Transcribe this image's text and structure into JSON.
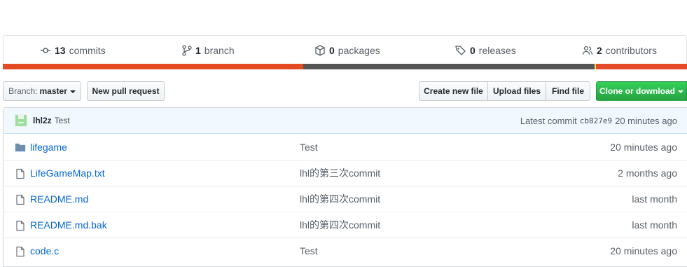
{
  "summary": {
    "commits": {
      "count": "13",
      "label": "commits"
    },
    "branch": {
      "count": "1",
      "label": "branch"
    },
    "packages": {
      "count": "0",
      "label": "packages"
    },
    "releases": {
      "count": "0",
      "label": "releases"
    },
    "contributors": {
      "count": "2",
      "label": "contributors"
    }
  },
  "language_colors": [
    "#e44b23",
    "#555555",
    "#f1e05a",
    "#e34c26"
  ],
  "toolbar": {
    "branch_prefix": "Branch:",
    "branch_name": "master",
    "new_pull_request": "New pull request",
    "create_new_file": "Create new file",
    "upload_files": "Upload files",
    "find_file": "Find file",
    "clone_or_download": "Clone or download"
  },
  "commit_tease": {
    "author": "lhl2z",
    "message": "Test",
    "latest_label": "Latest commit",
    "sha": "cb827e9",
    "age": "20 minutes ago"
  },
  "files": [
    {
      "type": "folder",
      "name": "lifegame",
      "message": "Test",
      "age": "20 minutes ago"
    },
    {
      "type": "file",
      "name": "LifeGameMap.txt",
      "message": "lhl的第三次commit",
      "age": "2 months ago"
    },
    {
      "type": "file",
      "name": "README.md",
      "message": "lhl的第四次commit",
      "age": "last month"
    },
    {
      "type": "file",
      "name": "README.md.bak",
      "message": "lhl的第四次commit",
      "age": "last month"
    },
    {
      "type": "file",
      "name": "code.c",
      "message": "Test",
      "age": "20 minutes ago"
    }
  ]
}
